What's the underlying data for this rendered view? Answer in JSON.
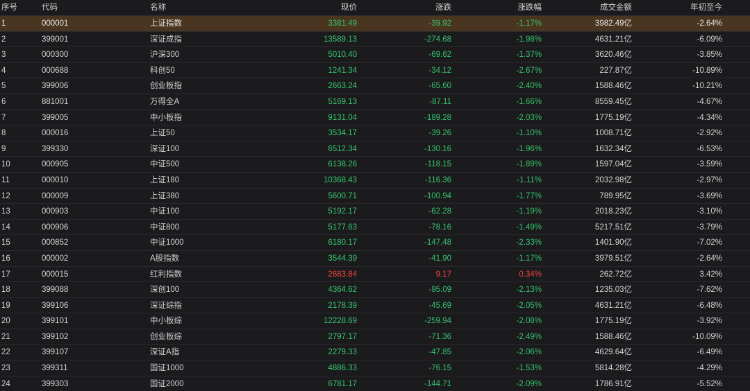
{
  "header": {
    "idx": "序号",
    "code": "代码",
    "name": "名称",
    "price": "现价",
    "change": "涨跌",
    "change_pct": "涨跌幅",
    "volume": "成交金额",
    "ytd": "年初至今"
  },
  "colors": {
    "down": "#36c36b",
    "up": "#f0443a",
    "selected_row": "#4a3520",
    "background": "#1b1b1e"
  },
  "selected_index": 0,
  "rows": [
    {
      "idx": "1",
      "code": "000001",
      "name": "上证指数",
      "price": "3381.49",
      "change": "-39.92",
      "change_pct": "-1.17%",
      "volume": "3982.49亿",
      "ytd": "-2.64%",
      "dir": "down"
    },
    {
      "idx": "2",
      "code": "399001",
      "name": "深证成指",
      "price": "13589.13",
      "change": "-274.68",
      "change_pct": "-1.98%",
      "volume": "4631.21亿",
      "ytd": "-6.09%",
      "dir": "down"
    },
    {
      "idx": "3",
      "code": "000300",
      "name": "沪深300",
      "price": "5010.40",
      "change": "-69.62",
      "change_pct": "-1.37%",
      "volume": "3620.46亿",
      "ytd": "-3.85%",
      "dir": "down"
    },
    {
      "idx": "4",
      "code": "000688",
      "name": "科创50",
      "price": "1241.34",
      "change": "-34.12",
      "change_pct": "-2.67%",
      "volume": "227.87亿",
      "ytd": "-10.89%",
      "dir": "down"
    },
    {
      "idx": "5",
      "code": "399006",
      "name": "创业板指",
      "price": "2663.24",
      "change": "-65.60",
      "change_pct": "-2.40%",
      "volume": "1588.46亿",
      "ytd": "-10.21%",
      "dir": "down"
    },
    {
      "idx": "6",
      "code": "881001",
      "name": "万得全A",
      "price": "5169.13",
      "change": "-87.11",
      "change_pct": "-1.66%",
      "volume": "8559.45亿",
      "ytd": "-4.67%",
      "dir": "down"
    },
    {
      "idx": "7",
      "code": "399005",
      "name": "中小板指",
      "price": "9131.04",
      "change": "-189.28",
      "change_pct": "-2.03%",
      "volume": "1775.19亿",
      "ytd": "-4.34%",
      "dir": "down"
    },
    {
      "idx": "8",
      "code": "000016",
      "name": "上证50",
      "price": "3534.17",
      "change": "-39.26",
      "change_pct": "-1.10%",
      "volume": "1008.71亿",
      "ytd": "-2.92%",
      "dir": "down"
    },
    {
      "idx": "9",
      "code": "399330",
      "name": "深证100",
      "price": "6512.34",
      "change": "-130.16",
      "change_pct": "-1.96%",
      "volume": "1632.34亿",
      "ytd": "-6.53%",
      "dir": "down"
    },
    {
      "idx": "10",
      "code": "000905",
      "name": "中证500",
      "price": "6138.26",
      "change": "-118.15",
      "change_pct": "-1.89%",
      "volume": "1597.04亿",
      "ytd": "-3.59%",
      "dir": "down"
    },
    {
      "idx": "11",
      "code": "000010",
      "name": "上证180",
      "price": "10368.43",
      "change": "-116.36",
      "change_pct": "-1.11%",
      "volume": "2032.98亿",
      "ytd": "-2.97%",
      "dir": "down"
    },
    {
      "idx": "12",
      "code": "000009",
      "name": "上证380",
      "price": "5600.71",
      "change": "-100.94",
      "change_pct": "-1.77%",
      "volume": "789.95亿",
      "ytd": "-3.69%",
      "dir": "down"
    },
    {
      "idx": "13",
      "code": "000903",
      "name": "中证100",
      "price": "5192.17",
      "change": "-62.28",
      "change_pct": "-1.19%",
      "volume": "2018.23亿",
      "ytd": "-3.10%",
      "dir": "down"
    },
    {
      "idx": "14",
      "code": "000906",
      "name": "中证800",
      "price": "5177.63",
      "change": "-78.16",
      "change_pct": "-1.49%",
      "volume": "5217.51亿",
      "ytd": "-3.79%",
      "dir": "down"
    },
    {
      "idx": "15",
      "code": "000852",
      "name": "中证1000",
      "price": "6180.17",
      "change": "-147.48",
      "change_pct": "-2.33%",
      "volume": "1401.90亿",
      "ytd": "-7.02%",
      "dir": "down"
    },
    {
      "idx": "16",
      "code": "000002",
      "name": "A股指数",
      "price": "3544.39",
      "change": "-41.90",
      "change_pct": "-1.17%",
      "volume": "3979.51亿",
      "ytd": "-2.64%",
      "dir": "down"
    },
    {
      "idx": "17",
      "code": "000015",
      "name": "红利指数",
      "price": "2683.84",
      "change": "9.17",
      "change_pct": "0.34%",
      "volume": "262.72亿",
      "ytd": "3.42%",
      "dir": "up"
    },
    {
      "idx": "18",
      "code": "399088",
      "name": "深创100",
      "price": "4364.62",
      "change": "-95.09",
      "change_pct": "-2.13%",
      "volume": "1235.03亿",
      "ytd": "-7.62%",
      "dir": "down"
    },
    {
      "idx": "19",
      "code": "399106",
      "name": "深证综指",
      "price": "2178.39",
      "change": "-45.69",
      "change_pct": "-2.05%",
      "volume": "4631.21亿",
      "ytd": "-6.48%",
      "dir": "down"
    },
    {
      "idx": "20",
      "code": "399101",
      "name": "中小板综",
      "price": "12228.69",
      "change": "-259.94",
      "change_pct": "-2.08%",
      "volume": "1775.19亿",
      "ytd": "-3.92%",
      "dir": "down"
    },
    {
      "idx": "21",
      "code": "399102",
      "name": "创业板综",
      "price": "2797.17",
      "change": "-71.36",
      "change_pct": "-2.49%",
      "volume": "1588.46亿",
      "ytd": "-10.09%",
      "dir": "down"
    },
    {
      "idx": "22",
      "code": "399107",
      "name": "深证A指",
      "price": "2279.33",
      "change": "-47.85",
      "change_pct": "-2.06%",
      "volume": "4629.64亿",
      "ytd": "-6.49%",
      "dir": "down"
    },
    {
      "idx": "23",
      "code": "399311",
      "name": "国证1000",
      "price": "4886.33",
      "change": "-76.15",
      "change_pct": "-1.53%",
      "volume": "5814.28亿",
      "ytd": "-4.29%",
      "dir": "down"
    },
    {
      "idx": "24",
      "code": "399303",
      "name": "国证2000",
      "price": "6781.17",
      "change": "-144.71",
      "change_pct": "-2.09%",
      "volume": "1786.91亿",
      "ytd": "-5.52%",
      "dir": "down"
    }
  ]
}
